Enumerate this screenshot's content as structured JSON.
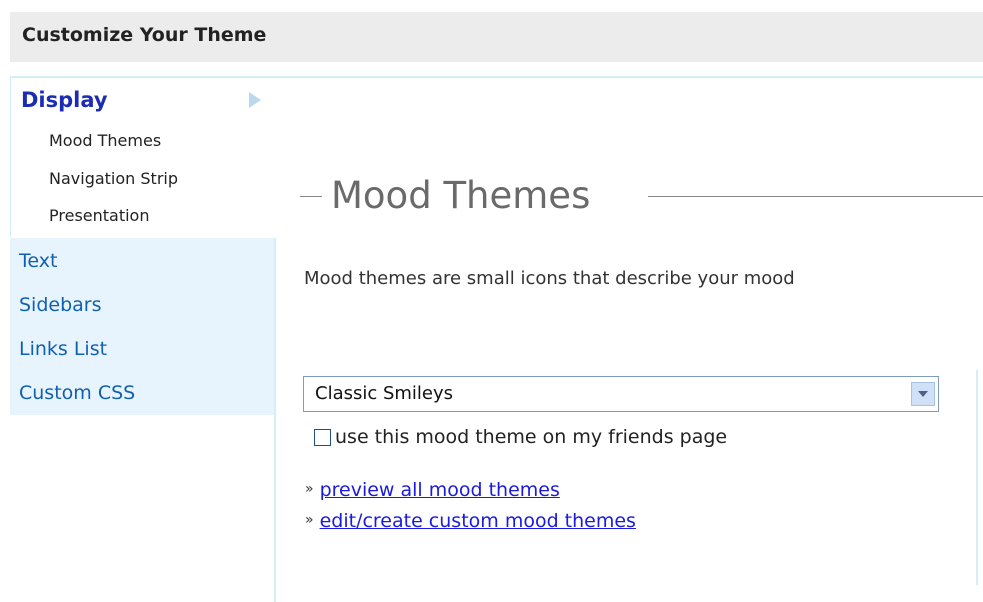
{
  "header": {
    "title": "Customize Your Theme"
  },
  "sidebar": {
    "active_section": "Display",
    "subitems": [
      "Mood Themes",
      "Navigation Strip",
      "Presentation"
    ],
    "items": [
      "Text",
      "Sidebars",
      "Links List",
      "Custom CSS"
    ]
  },
  "main": {
    "title": "Mood Themes",
    "description": "Mood themes are small icons that describe your mood",
    "select": {
      "value": "Classic Smileys"
    },
    "checkbox": {
      "label": "use this mood theme on my friends page",
      "checked": false
    },
    "links": [
      "preview all mood themes",
      "edit/create custom mood themes"
    ],
    "link_marker": "»"
  },
  "colors": {
    "active_section": "#1c2cb4",
    "sidebar_link": "#1060b0",
    "link": "#1a1ae0",
    "sidebar_bg": "#e8f4fd"
  }
}
